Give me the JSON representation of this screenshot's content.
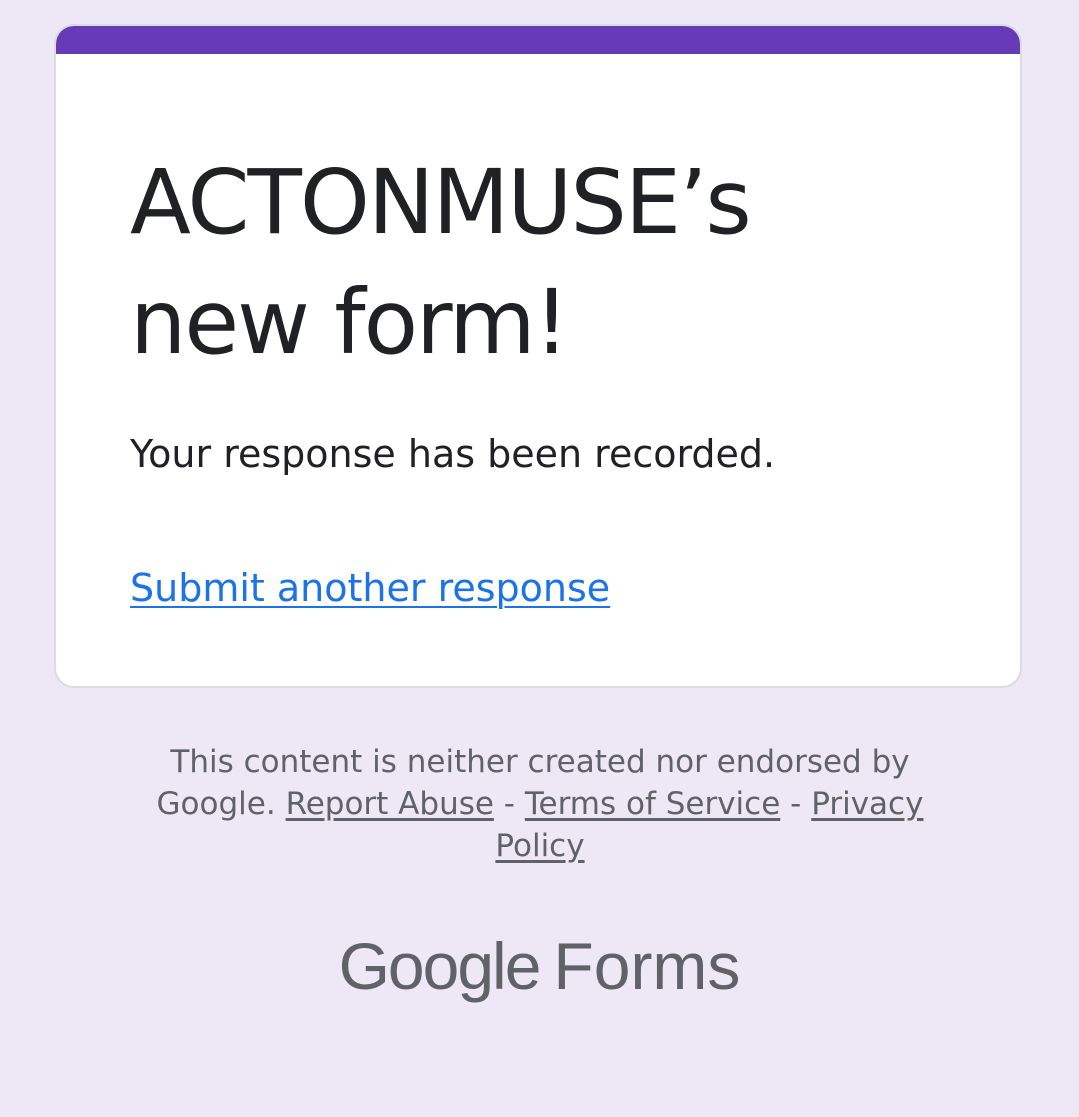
{
  "form": {
    "title": "ACTONMUSE’s new form!",
    "confirmation_message": "Your response has been recorded.",
    "submit_another_label": "Submit another response"
  },
  "footer": {
    "disclaimer": "This content is neither created nor endorsed by Google.",
    "report_abuse_label": "Report Abuse",
    "separator": "-",
    "terms_label": "Terms of Service",
    "privacy_label": "Privacy Policy"
  },
  "brand": {
    "google": "Google",
    "forms": "Forms"
  },
  "colors": {
    "page_background": "#ede7f6",
    "accent": "#673ab7",
    "link": "#1a73e8",
    "text_primary": "#202124",
    "text_secondary": "#5f6368"
  }
}
